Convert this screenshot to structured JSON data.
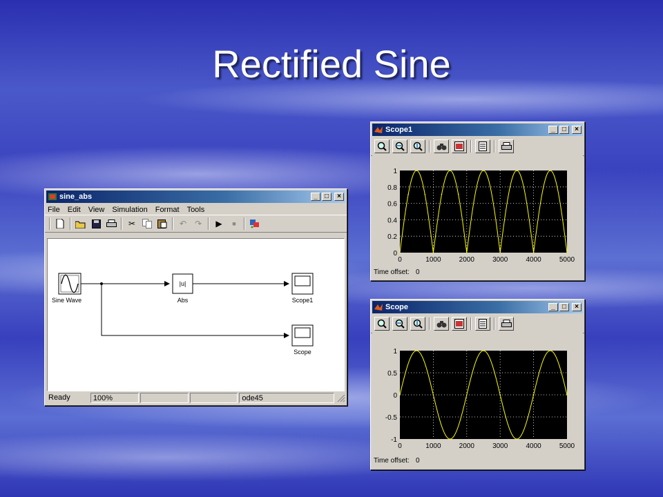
{
  "slide": {
    "title": "Rectified Sine"
  },
  "model_window": {
    "title": "sine_abs",
    "menu": [
      "File",
      "Edit",
      "View",
      "Simulation",
      "Format",
      "Tools"
    ],
    "toolbar_icons": [
      "new-icon",
      "open-icon",
      "save-icon",
      "print-icon",
      "cut-icon",
      "copy-icon",
      "paste-icon",
      "undo-icon",
      "redo-icon",
      "start-simulation-icon",
      "stop-simulation-icon",
      "library-browser-icon"
    ],
    "blocks": {
      "sine": "Sine Wave",
      "abs_symbol": "|u|",
      "abs": "Abs",
      "scope1": "Scope1",
      "scope": "Scope"
    },
    "status": {
      "state": "Ready",
      "zoom": "100%",
      "cell3": "",
      "cell4": "",
      "solver": "ode45"
    }
  },
  "scope1_window": {
    "title": "Scope1",
    "toolbar_icons": [
      "zoom-icon",
      "zoom-x-icon",
      "zoom-y-icon",
      "autoscale-icon",
      "save-axes-icon",
      "parameters-icon",
      "print-icon"
    ],
    "time_offset_label": "Time offset:",
    "time_offset_value": "0"
  },
  "scope_window": {
    "title": "Scope",
    "toolbar_icons": [
      "zoom-icon",
      "zoom-x-icon",
      "zoom-y-icon",
      "autoscale-icon",
      "save-axes-icon",
      "parameters-icon",
      "print-icon"
    ],
    "time_offset_label": "Time offset:",
    "time_offset_value": "0"
  },
  "colors": {
    "trace": "#ffff00",
    "plot_bg": "#000000",
    "grid": "#ffffff",
    "titlebar": "#0a246a"
  },
  "chart_data": [
    {
      "type": "line",
      "name": "Scope1",
      "function": "abs(sin)",
      "amplitude": 1,
      "period_of_sine": 2000,
      "xlim": [
        0,
        5000
      ],
      "ylim": [
        0,
        1
      ],
      "xticks": [
        "0",
        "1000",
        "2000",
        "3000",
        "4000",
        "5000"
      ],
      "yticks": [
        "1",
        "0.8",
        "0.6",
        "0.4",
        "0.2",
        "0"
      ],
      "x": [
        0,
        250,
        500,
        750,
        1000,
        1250,
        1500,
        1750,
        2000,
        2500,
        3000,
        3500,
        4000,
        4500,
        5000
      ],
      "values": [
        0,
        0.71,
        1,
        0.71,
        0,
        0.71,
        1,
        0.71,
        0,
        1,
        0,
        1,
        0,
        1,
        0
      ],
      "grid": true
    },
    {
      "type": "line",
      "name": "Scope",
      "function": "sin",
      "amplitude": 1,
      "period_of_sine": 2000,
      "xlim": [
        0,
        5000
      ],
      "ylim": [
        -1,
        1
      ],
      "xticks": [
        "0",
        "1000",
        "2000",
        "3000",
        "4000",
        "5000"
      ],
      "yticks": [
        "1",
        "0.5",
        "0",
        "-0.5",
        "-1"
      ],
      "x": [
        0,
        500,
        1000,
        1500,
        2000,
        2500,
        3000,
        3500,
        4000,
        4500,
        5000
      ],
      "values": [
        0,
        1,
        0,
        -1,
        0,
        1,
        0,
        -1,
        0,
        1,
        0
      ],
      "grid": true
    }
  ]
}
